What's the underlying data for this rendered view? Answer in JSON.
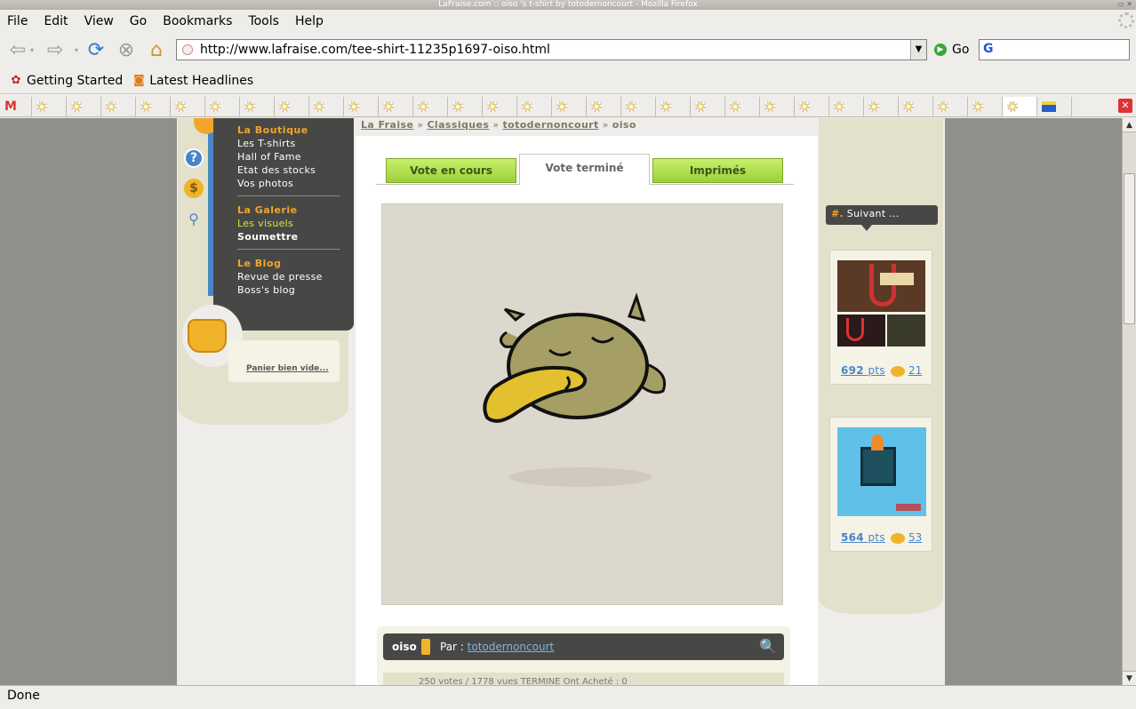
{
  "window": {
    "title": "LaFraise.com :: oiso 's t-shirt by totodernoncourt - Mozilla Firefox"
  },
  "menu": [
    "File",
    "Edit",
    "View",
    "Go",
    "Bookmarks",
    "Tools",
    "Help"
  ],
  "toolbar": {
    "url": "http://www.lafraise.com/tee-shirt-11235p1697-oiso.html",
    "go_label": "Go",
    "search_placeholder": "G"
  },
  "bookmarks": [
    "Getting Started",
    "Latest Headlines"
  ],
  "status": "Done",
  "site": {
    "breadcrumb": [
      "La Fraise",
      "Classiques",
      "totodernoncourt",
      "oiso"
    ],
    "nav": {
      "boutique": {
        "heading": "La Boutique",
        "items": [
          "Les T-shirts",
          "Hall of Fame",
          "Etat des stocks",
          "Vos photos"
        ]
      },
      "galerie": {
        "heading": "La Galerie",
        "items": [
          "Les visuels",
          "Soumettre"
        ]
      },
      "blog": {
        "heading": "Le Blog",
        "items": [
          "Revue de presse",
          "Boss's blog"
        ]
      }
    },
    "panier": "Panier bien vide...",
    "tabs": [
      "Vote en cours",
      "Vote terminé",
      "Imprimés"
    ],
    "design": {
      "name": "oiso",
      "par_label": "Par :",
      "author": "totodernoncourt",
      "stats": "250 votes / 1778 vues   TERMINE   Ont Acheté : 0"
    },
    "suivant": {
      "hash": "#.",
      "label": "Suivant ..."
    },
    "next": [
      {
        "points": "692",
        "unit": "pts",
        "comments": "21"
      },
      {
        "points": "564",
        "unit": "pts",
        "comments": "53"
      }
    ]
  },
  "colors": {
    "accent_orange": "#f2a52a",
    "dark_panel": "#474846",
    "tab_green": "#9bd13a",
    "link_blue": "#4a84c9"
  }
}
